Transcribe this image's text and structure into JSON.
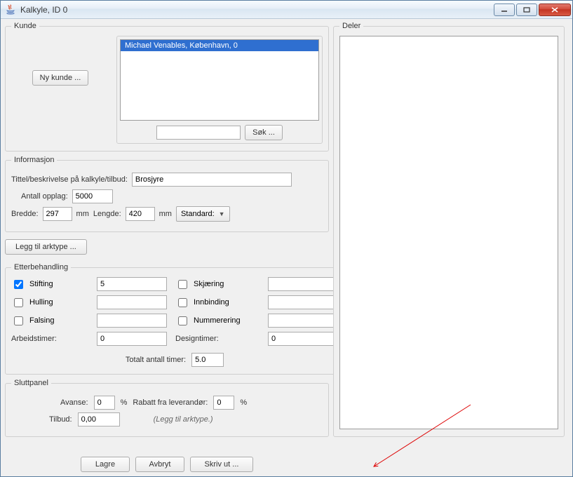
{
  "window": {
    "title": "Kalkyle, ID 0"
  },
  "kunde": {
    "legend": "Kunde",
    "new_button": "Ny kunde ...",
    "list": [
      "Michael Venables, København, 0"
    ],
    "search_button": "Søk ..."
  },
  "deler": {
    "legend": "Deler"
  },
  "info": {
    "legend": "Informasjon",
    "title_label": "Tittel/beskrivelse på kalkyle/tilbud:",
    "title_value": "Brosjyre",
    "opplag_label": "Antall opplag:",
    "opplag_value": "5000",
    "bredde_label": "Bredde:",
    "bredde_value": "297",
    "mm1": "mm",
    "lengde_label": "Lengde:",
    "lengde_value": "420",
    "mm2": "mm",
    "standard_label": "Standard:"
  },
  "arktype": {
    "button": "Legg til arktype ..."
  },
  "etter": {
    "legend": "Etterbehandling",
    "stifting_label": "Stifting",
    "stifting_checked": true,
    "stifting_value": "5",
    "skjaering_label": "Skjæring",
    "hulling_label": "Hulling",
    "innbinding_label": "Innbinding",
    "falsing_label": "Falsing",
    "nummerering_label": "Nummerering",
    "arbeidstimer_label": "Arbeidstimer:",
    "arbeidstimer_value": "0",
    "designtimer_label": "Designtimer:",
    "designtimer_value": "0",
    "total_label": "Totalt antall timer:",
    "total_value": "5.0"
  },
  "slutt": {
    "legend": "Sluttpanel",
    "avanse_label": "Avanse:",
    "avanse_value": "0",
    "pct1": "%",
    "rabatt_label": "Rabatt fra leverandør:",
    "rabatt_value": "0",
    "pct2": "%",
    "tilbud_label": "Tilbud:",
    "tilbud_value": "0,00",
    "note": "(Legg til arktype.)"
  },
  "buttons": {
    "save": "Lagre",
    "cancel": "Avbryt",
    "print": "Skriv ut ..."
  }
}
